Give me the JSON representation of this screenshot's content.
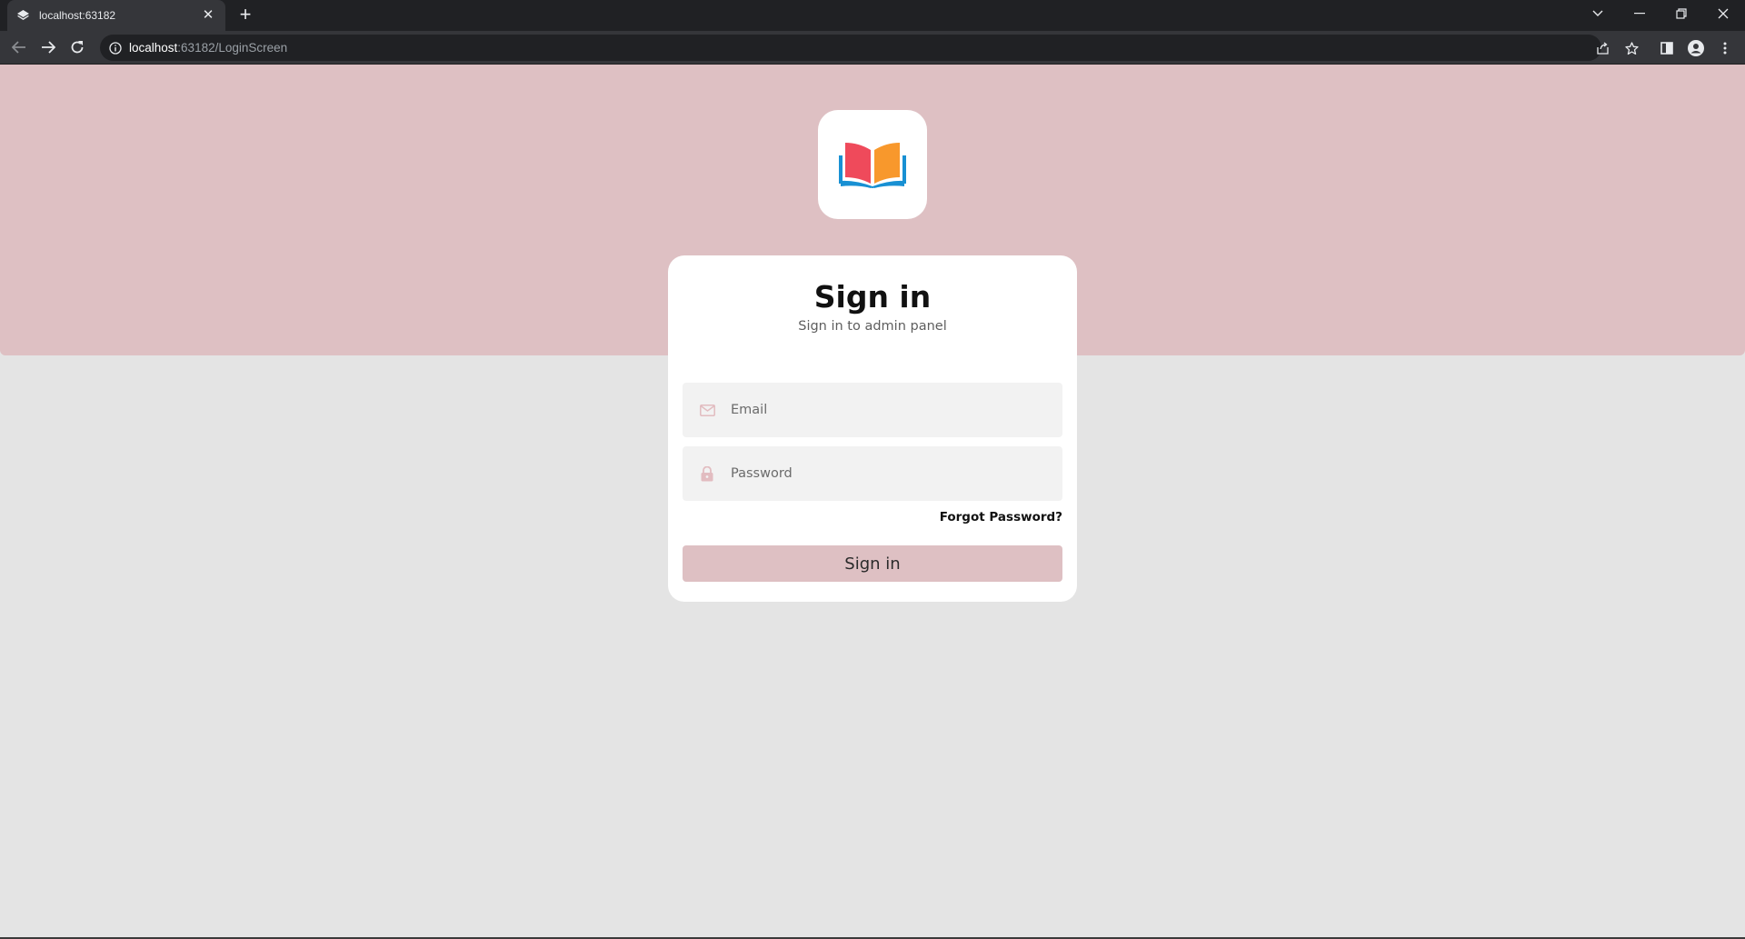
{
  "browser": {
    "tab_title": "localhost:63182",
    "url_host": "localhost",
    "url_rest": ":63182/LoginScreen"
  },
  "page": {
    "colors": {
      "hero": "#dec0c3",
      "background": "#e4e4e4",
      "card": "#ffffff",
      "button": "#dec0c3",
      "icon": "#e2bcc0"
    },
    "logo": {
      "icon": "open-book-icon"
    },
    "card": {
      "title": "Sign in",
      "subtitle": "Sign in to admin panel"
    },
    "email": {
      "placeholder": "Email",
      "icon": "mail-icon"
    },
    "password": {
      "placeholder": "Password",
      "icon": "lock-icon"
    },
    "forgot_label": "Forgot Password?",
    "submit_label": "Sign in"
  }
}
